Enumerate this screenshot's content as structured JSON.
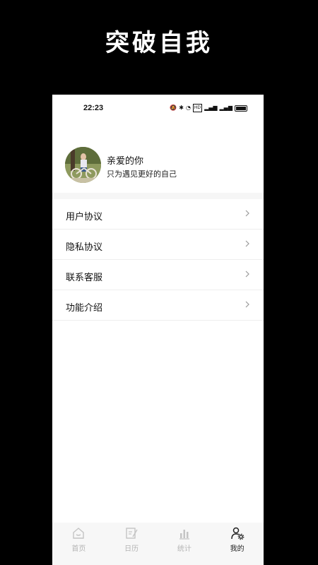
{
  "banner": {
    "title": "突破自我"
  },
  "status_bar": {
    "time": "22:23",
    "icons": [
      "mute-icon",
      "bluetooth-icon",
      "wifi-icon",
      "hd-icon",
      "signal-icon",
      "signal-icon-2",
      "battery-icon"
    ],
    "hd_text": "HD"
  },
  "profile": {
    "name": "亲爱的你",
    "motto": "只为遇见更好的自己"
  },
  "menu": {
    "items": [
      {
        "label": "用户协议"
      },
      {
        "label": "隐私协议"
      },
      {
        "label": "联系客服"
      },
      {
        "label": "功能介绍"
      }
    ]
  },
  "tabbar": {
    "tabs": [
      {
        "label": "首页",
        "icon": "home-icon",
        "active": false
      },
      {
        "label": "日历",
        "icon": "calendar-edit-icon",
        "active": false
      },
      {
        "label": "统计",
        "icon": "stats-icon",
        "active": false
      },
      {
        "label": "我的",
        "icon": "profile-settings-icon",
        "active": true
      }
    ]
  },
  "colors": {
    "background": "#000000",
    "panel": "#ffffff",
    "separator": "#f1f1f1",
    "tab_inactive": "#b5b5b5",
    "tab_active": "#222222"
  }
}
